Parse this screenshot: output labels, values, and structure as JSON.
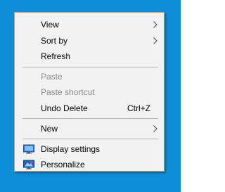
{
  "desktop": {
    "background_color": "#0c8fd6"
  },
  "context_menu": {
    "items": [
      {
        "label": "View",
        "has_submenu": true
      },
      {
        "label": "Sort by",
        "has_submenu": true
      },
      {
        "label": "Refresh"
      },
      {
        "label": "Paste",
        "disabled": true
      },
      {
        "label": "Paste shortcut",
        "disabled": true
      },
      {
        "label": "Undo Delete",
        "shortcut": "Ctrl+Z"
      },
      {
        "label": "New",
        "has_submenu": true
      },
      {
        "label": "Display settings",
        "icon": "display-settings-icon"
      },
      {
        "label": "Personalize",
        "icon": "personalize-icon"
      }
    ]
  }
}
